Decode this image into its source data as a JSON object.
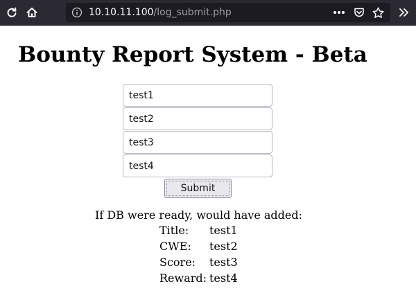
{
  "browser": {
    "url_host": "10.10.11.100",
    "url_path": "/log_submit.php"
  },
  "page": {
    "title": "Bounty Report System - Beta",
    "fields": [
      {
        "value": "test1"
      },
      {
        "value": "test2"
      },
      {
        "value": "test3"
      },
      {
        "value": "test4"
      }
    ],
    "submit_label": "Submit",
    "result": {
      "intro": "If DB were ready, would have added:",
      "rows": [
        {
          "label": "Title:",
          "value": "test1"
        },
        {
          "label": "CWE:",
          "value": "test2"
        },
        {
          "label": "Score:",
          "value": "test3"
        },
        {
          "label": "Reward:",
          "value": "test4"
        }
      ]
    }
  }
}
